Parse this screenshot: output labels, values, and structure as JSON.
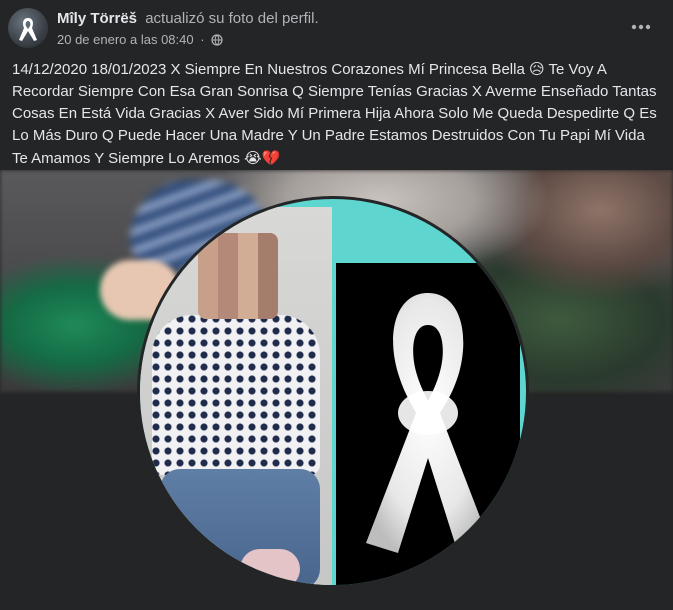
{
  "post": {
    "author": "Mîly Törrëš",
    "action": "actualizó su foto del perfil.",
    "date": "20 de enero a las 08:40",
    "separator": "·",
    "visibility_icon": "globe-icon",
    "more_icon": "ellipsis-icon",
    "caption_text": "14/12/2020 18/01/2023 X Siempre En Nuestros Corazones Mí Princesa Bella ",
    "caption_emoji_1": "😥",
    "caption_text_2": " Te Voy A Recordar Siempre Con Esa Gran Sonrisa Q Siempre Tenías Gracias X Averme Enseñado Tantas Cosas En Está Vida Gracias X Aver Sido Mí Primera Hija Ahora Solo Me Queda Despedirte Q Es Lo Más Duro Q Puede Hacer Una Madre Y Un Padre Estamos Destruidos Con Tu Papi Mí Vida Te Amamos Y Siempre Lo Aremos ",
    "caption_emoji_2": "😭💔"
  },
  "colors": {
    "background": "#242526",
    "primary_text": "#e4e6eb",
    "secondary_text": "#b0b3b8",
    "frame_accent": "#5fd5cf"
  }
}
